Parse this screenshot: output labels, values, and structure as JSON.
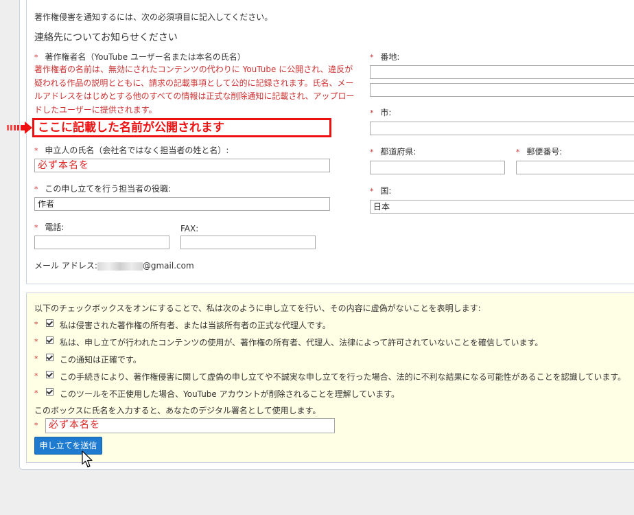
{
  "intro": "著作権侵害を通知するには、次の必須項目に記入してください。",
  "contact_heading": "連絡先についてお知らせください",
  "required_mark": "*",
  "fields": {
    "owner_name_label": "著作権者名（YouTube ユーザー名または本名の氏名）",
    "owner_name_desc": "著作権者の名前は、無効にされたコンテンツの代わりに YouTube に公開され、違反が疑われる作品の説明とともに、請求の記載事項として公的に記録されます。氏名、メールアドレスをはじめとする他のすべての情報は正式な削除通知に記載され、アップロードしたユーザーに提供されます。",
    "owner_name_annotation": "ここに記載した名前が公開されます",
    "applicant_label": "申立人の氏名（会社名ではなく担当者の姓と名）:",
    "applicant_value": "必ず本名を",
    "role_label": "この申し立てを行う担当者の役職:",
    "role_value": "作者",
    "phone_label": "電話:",
    "fax_label": "FAX:",
    "email_label": "メール アドレス:",
    "email_suffix": "@gmail.com",
    "address_label": "番地:",
    "city_label": "市:",
    "prefecture_label": "都道府県:",
    "zip_label": "郵便番号:",
    "country_label": "国:",
    "country_value": "日本"
  },
  "declaration": {
    "intro": "以下のチェックボックスをオンにすることで、私は次のように申し立てを行い、その内容に虚偽がないことを表明します:",
    "items": [
      "私は侵害された著作権の所有者、または当該所有者の正式な代理人です。",
      "私は、申し立てが行われたコンテンツの使用が、著作権の所有者、代理人、法律によって許可されていないことを確信しています。",
      "この通知は正確です。",
      "この手続きにより、著作権侵害に関して虚偽の申し立てや不誠実な申し立てを行った場合、法的に不利な結果になる可能性があることを認識しています。",
      "このツールを不正使用した場合、YouTube アカウントが削除されることを理解しています。"
    ],
    "signature_label": "このボックスに氏名を入力すると、あなたのデジタル署名として使用します。",
    "signature_value": "必ず本名を"
  },
  "submit_label": "申し立てを送信",
  "colors": {
    "required": "#cc3333",
    "annotation": "#ee1111",
    "button": "#1f7bcf",
    "declaration_bg": "#ffffe5"
  },
  "icons": [
    "red-arrow-icon",
    "checkbox-checked-icon",
    "mouse-pointer-icon"
  ]
}
